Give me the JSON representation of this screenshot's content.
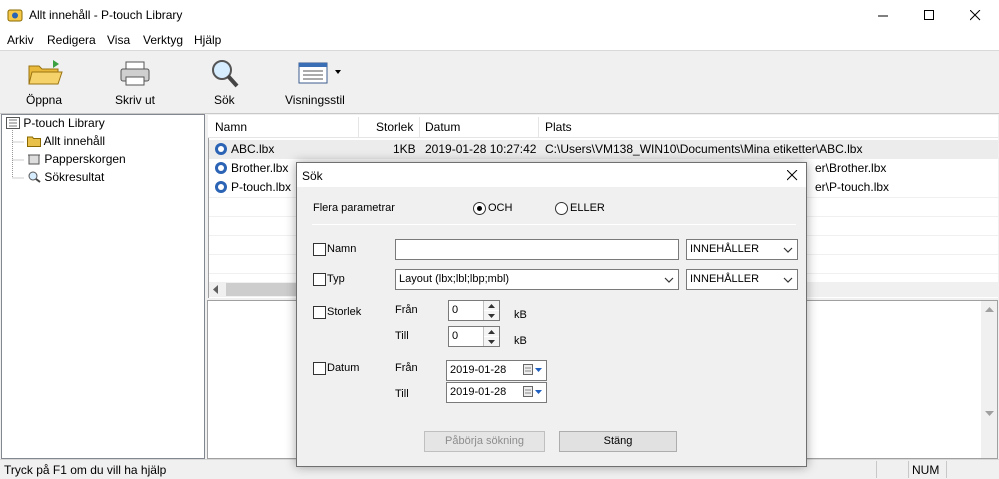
{
  "window": {
    "title": "Allt innehåll - P-touch Library",
    "controls": [
      "minimize-icon",
      "maximize-icon",
      "close-icon"
    ]
  },
  "menu": [
    "Arkiv",
    "Redigera",
    "Visa",
    "Verktyg",
    "Hjälp"
  ],
  "toolbar": {
    "open_label": "Öppna",
    "print_label": "Skriv ut",
    "search_label": "Sök",
    "view_label": "Visningsstil"
  },
  "tree": {
    "root": "P-touch Library",
    "items": [
      "Allt innehåll",
      "Papperskorgen",
      "Sökresultat"
    ]
  },
  "list": {
    "columns": [
      "Namn",
      "Storlek",
      "Datum",
      "Plats"
    ],
    "rows": [
      {
        "name": "ABC.lbx",
        "size": "1KB",
        "date": "2019-01-28 10:27:42",
        "location": "C:\\Users\\VM138_WIN10\\Documents\\Mina etiketter\\ABC.lbx"
      },
      {
        "name": "Brother.lbx",
        "size": "",
        "date": "",
        "location": "er\\Brother.lbx"
      },
      {
        "name": "P-touch.lbx",
        "size": "",
        "date": "",
        "location": "er\\P-touch.lbx"
      }
    ]
  },
  "status": {
    "help_text": "Tryck på F1 om du vill ha hjälp",
    "num": "NUM"
  },
  "dialog": {
    "title": "Sök",
    "multi_params_label": "Flera parametrar",
    "och_label": "OCH",
    "eller_label": "ELLER",
    "och_selected": true,
    "name_label": "Namn",
    "name_value": "",
    "name_operator": "INNEHÅLLER",
    "type_label": "Typ",
    "type_value": "Layout (lbx;lbl;lbp;mbl)",
    "type_operator": "INNEHÅLLER",
    "size_label": "Storlek",
    "from_label": "Från",
    "to_label": "Till",
    "size_from": "0",
    "size_to": "0",
    "unit_kb": "kB",
    "date_label": "Datum",
    "date_from": "2019-01-28",
    "date_to": "2019-01-28",
    "start_button": "Påbörja sökning",
    "close_button": "Stäng"
  }
}
